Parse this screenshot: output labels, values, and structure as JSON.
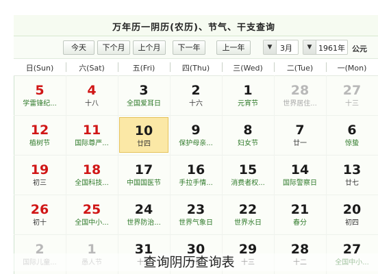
{
  "header": {
    "title": "万年历一阴历(农历)、节气、干支查询"
  },
  "toolbar": {
    "gongyuan_label": "公元",
    "year_value": "1961年",
    "month_value": "3月",
    "buttons": [
      "上一年",
      "下一年",
      "上个月",
      "下个月",
      "今天"
    ]
  },
  "weekdays": [
    "一(Mon)",
    "二(Tue)",
    "三(Wed)",
    "四(Thu)",
    "五(Fri)",
    "六(Sat)",
    "日(Sun)"
  ],
  "calendar": {
    "weeks": [
      [
        {
          "num": "27",
          "sub": "十三",
          "other": true
        },
        {
          "num": "28",
          "sub": "世界居住...",
          "other": true
        },
        {
          "num": "1",
          "sub": "元宵节",
          "green": true
        },
        {
          "num": "2",
          "sub": "十六"
        },
        {
          "num": "3",
          "sub": "全国爱耳日",
          "green": true
        },
        {
          "num": "4",
          "sub": "十八",
          "weekend": true
        },
        {
          "num": "5",
          "sub": "学雷锋纪...",
          "weekend": true,
          "green": true
        }
      ],
      [
        {
          "num": "6",
          "sub": "惊蛰",
          "green": true
        },
        {
          "num": "7",
          "sub": "廿一"
        },
        {
          "num": "8",
          "sub": "妇女节",
          "green": true
        },
        {
          "num": "9",
          "sub": "保护母亲...",
          "green": true
        },
        {
          "num": "10",
          "sub": "廿四",
          "today": true
        },
        {
          "num": "11",
          "sub": "国际尊严...",
          "weekend": true,
          "green": true
        },
        {
          "num": "12",
          "sub": "植树节",
          "weekend": true,
          "green": true
        }
      ],
      [
        {
          "num": "13",
          "sub": "廿七"
        },
        {
          "num": "14",
          "sub": "国际警察日",
          "green": true
        },
        {
          "num": "15",
          "sub": "消费者权...",
          "green": true
        },
        {
          "num": "16",
          "sub": "手拉手情...",
          "green": true
        },
        {
          "num": "17",
          "sub": "中国国医节",
          "green": true
        },
        {
          "num": "18",
          "sub": "全国科技...",
          "weekend": true,
          "green": true
        },
        {
          "num": "19",
          "sub": "初三",
          "weekend": true
        }
      ],
      [
        {
          "num": "20",
          "sub": "初四"
        },
        {
          "num": "21",
          "sub": "春分",
          "green": true
        },
        {
          "num": "22",
          "sub": "世界水日",
          "green": true
        },
        {
          "num": "23",
          "sub": "世界气象日",
          "green": true
        },
        {
          "num": "24",
          "sub": "世界防治...",
          "green": true
        },
        {
          "num": "25",
          "sub": "全国中小...",
          "weekend": true,
          "green": true
        },
        {
          "num": "26",
          "sub": "初十",
          "weekend": true
        }
      ],
      [
        {
          "num": "27",
          "sub": "全国中小...",
          "green": true
        },
        {
          "num": "28",
          "sub": "十二"
        },
        {
          "num": "29",
          "sub": "十三"
        },
        {
          "num": "30",
          "sub": "十四"
        },
        {
          "num": "31",
          "sub": "十五"
        },
        {
          "num": "1",
          "sub": "愚人节",
          "other": true
        },
        {
          "num": "2",
          "sub": "国际儿童...",
          "other": true
        }
      ]
    ]
  },
  "caption": "查询阴历查询表"
}
